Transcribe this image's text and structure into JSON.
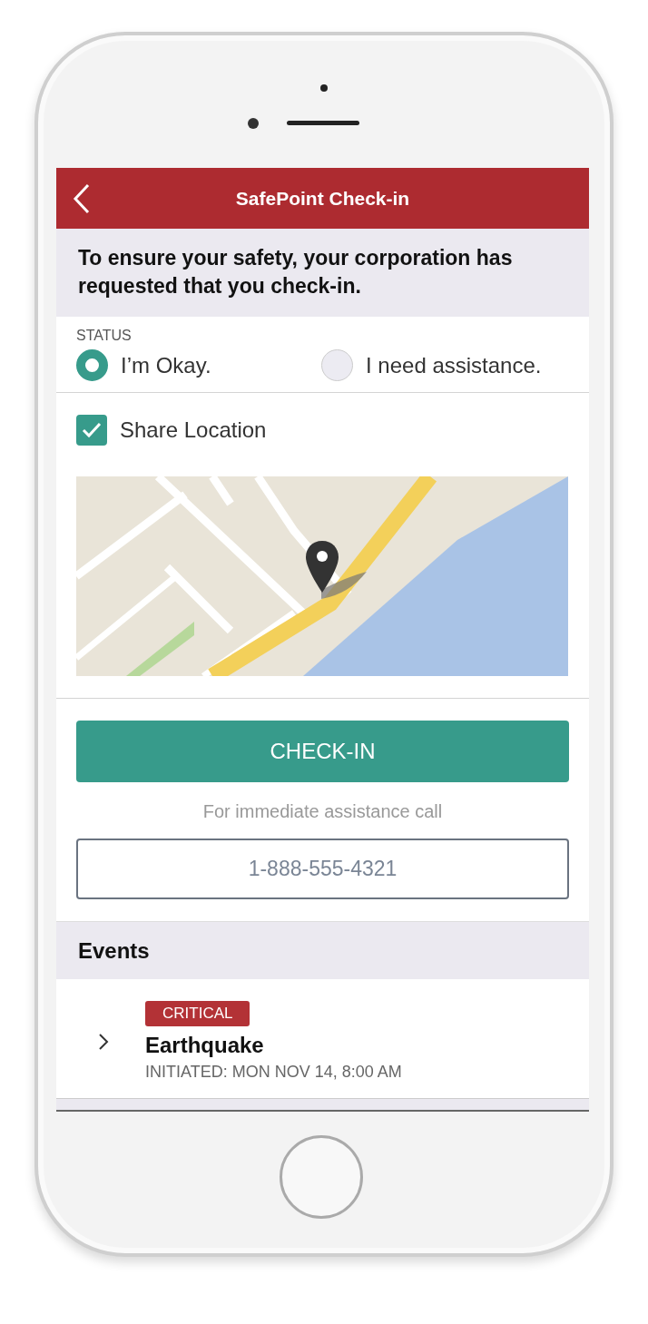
{
  "header": {
    "title": "SafePoint Check-in"
  },
  "notice": "To ensure your safety, your corporation has requested that you check-in.",
  "status": {
    "label": "STATUS",
    "options": [
      {
        "label": "I’m Okay.",
        "selected": true
      },
      {
        "label": "I need assistance.",
        "selected": false
      }
    ]
  },
  "share_location": {
    "label": "Share Location",
    "checked": true
  },
  "checkin_button": "CHECK-IN",
  "assistance_text": "For immediate assistance call",
  "phone_number": "1-888-555-4321",
  "events": {
    "title": "Events",
    "items": [
      {
        "severity": "CRITICAL",
        "name": "Earthquake",
        "initiated": "INITIATED: MON NOV 14, 8:00 AM"
      }
    ]
  }
}
